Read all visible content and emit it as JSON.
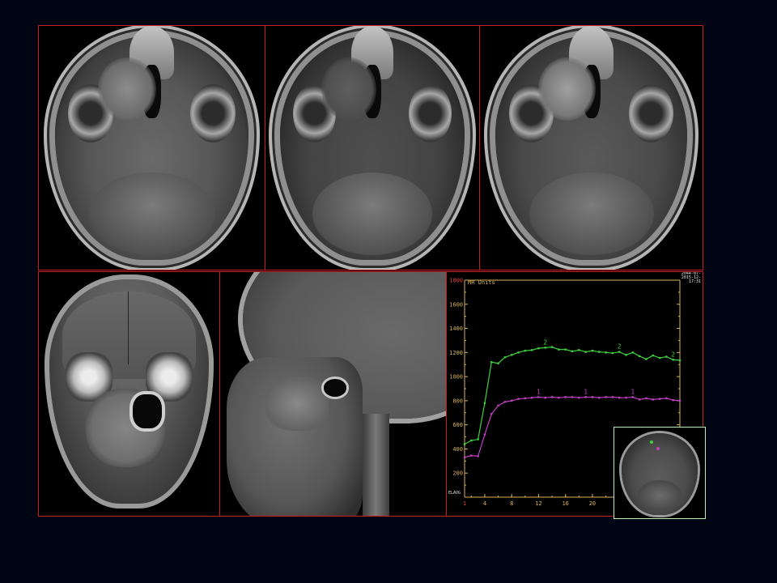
{
  "chart_data": {
    "type": "line",
    "title": "MR Units",
    "xlim": [
      1,
      33
    ],
    "ylim": [
      0,
      1800
    ],
    "xticks": [
      "1",
      "4",
      "8",
      "12",
      "16",
      "20",
      "24"
    ],
    "yticks": [
      200,
      400,
      600,
      800,
      1000,
      1200,
      1400,
      1600,
      1800
    ],
    "ytick_labels": [
      "200",
      "400",
      "600",
      "800",
      "1000",
      "1200",
      "1400",
      "1600",
      "1800"
    ],
    "grid": false,
    "x": [
      1,
      2,
      3,
      4,
      5,
      6,
      7,
      8,
      9,
      10,
      11,
      12,
      13,
      14,
      15,
      16,
      17,
      18,
      19,
      20,
      21,
      22,
      23,
      24,
      25,
      26,
      27,
      28,
      29,
      30,
      31,
      32,
      33
    ],
    "series": [
      {
        "name": "2",
        "color": "#3ecf3e",
        "values": [
          440,
          470,
          480,
          780,
          1120,
          1110,
          1160,
          1180,
          1200,
          1215,
          1220,
          1235,
          1240,
          1245,
          1225,
          1225,
          1210,
          1220,
          1205,
          1215,
          1205,
          1200,
          1195,
          1205,
          1180,
          1200,
          1170,
          1145,
          1175,
          1155,
          1165,
          1140,
          1135
        ]
      },
      {
        "name": "1",
        "color": "#c23ec2",
        "values": [
          330,
          345,
          340,
          520,
          690,
          760,
          790,
          800,
          815,
          820,
          825,
          830,
          825,
          830,
          825,
          830,
          830,
          825,
          830,
          830,
          825,
          830,
          830,
          825,
          825,
          830,
          810,
          820,
          810,
          815,
          820,
          805,
          800
        ]
      }
    ],
    "marker_labels": {
      "2": [
        13,
        24,
        32
      ],
      "1": [
        12,
        19,
        26
      ]
    },
    "bottom_left_label": "ELAVG"
  },
  "overlay": {
    "corner_info": [
      "2044-07-",
      "2015-12-",
      "17:31"
    ]
  },
  "colors": {
    "panel_border": "#c81e1e",
    "axis": "#d4b35a",
    "label": "#d4b35a",
    "inset_border": "#b7f0b7"
  },
  "icons": {
    "roi_markers": [
      "roi-1",
      "roi-2"
    ]
  }
}
